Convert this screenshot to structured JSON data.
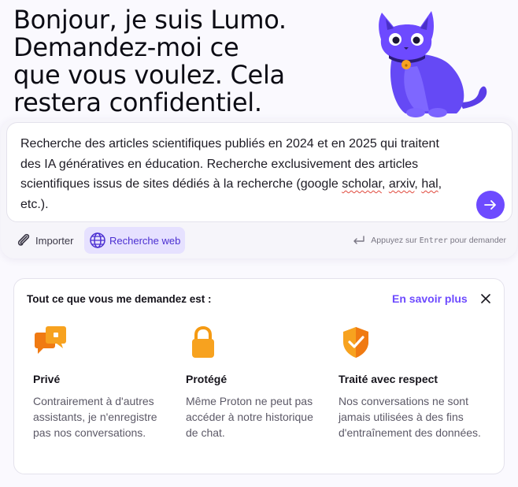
{
  "hero": {
    "title": "Bonjour, je suis Lumo.\nDemandez-moi ce\nque vous voulez. Cela\nrestera confidentiel."
  },
  "composer": {
    "text_parts": [
      "Recherche des articles scientifiques publiés en 2024 et en 2025 qui traitent des IA génératives en éducation. Recherche exclusivement des articles scientifiques issus de sites dédiés à la recherche (google ",
      "scholar",
      ", ",
      "arxiv",
      ", ",
      "hal",
      ", etc.)."
    ],
    "import_label": "Importer",
    "web_search_label": "Recherche web",
    "hint_prefix": "Appuyez sur",
    "hint_key": "Entrer",
    "hint_suffix": "pour demander"
  },
  "info_card": {
    "heading": "Tout ce que vous me demandez est :",
    "learn_more": "En savoir plus",
    "features": [
      {
        "title": "Privé",
        "description": "Contrairement à d'autres assistants, je n'enregistre pas nos conversations.",
        "icon": "chat-bubbles-icon"
      },
      {
        "title": "Protégé",
        "description": "Même Proton ne peut pas accéder à notre historique de chat.",
        "icon": "lock-icon"
      },
      {
        "title": "Traité avec respect",
        "description": "Nos conversations ne sont jamais utilisées à des fins d'entraînement des données.",
        "icon": "shield-check-icon"
      }
    ]
  },
  "colors": {
    "accent": "#6d4aff",
    "icon_orange": "#f79a1f",
    "background": "#faf9fe"
  }
}
